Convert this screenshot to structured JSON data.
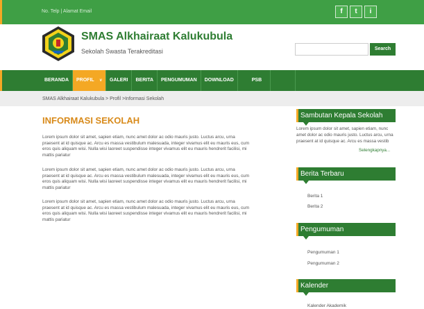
{
  "topbar": {
    "contact": "No. Telp | Alamat Email"
  },
  "social": [
    {
      "label": "f",
      "icon": "facebook-icon"
    },
    {
      "label": "t",
      "icon": "twitter-icon"
    },
    {
      "label": "i",
      "icon": "instagram-icon"
    }
  ],
  "header": {
    "school_name": "SMAS Alkhairaat Kalukubula",
    "subtitle": "Sekolah Swasta Terakreditasi",
    "search_placeholder": "",
    "search_button": "Search"
  },
  "nav": {
    "items": [
      {
        "label": "BERANDA"
      },
      {
        "label": "PROFIL",
        "active": true,
        "caret": "v"
      },
      {
        "label": "GALERI"
      },
      {
        "label": "BERITA"
      },
      {
        "label": "PENGUMUMAN"
      },
      {
        "label": "DOWNLOAD"
      },
      {
        "label": "PSB"
      }
    ]
  },
  "breadcrumb": "SMAS Alkhairaat Kalukubula > Profil >Informasi Sekolah",
  "main": {
    "title": "INFORMASI SEKOLAH",
    "paragraphs": [
      "Lorem ipsum dolor sit amet, sapien etiam, nunc amet dolor ac odio mauris justo. Luctus arcu, urna praesent at id quisque ac. Arcu es massa vestibulum malesuada, integer vivamus elit eu mauris eus, cum eros quis aliquam wisi. Nulla wisi laoreet suspendisse integer vivamus elit eu mauris hendrerit facilisi, mi mattis pariatur",
      "Lorem ipsum dolor sit amet, sapien etiam, nunc amet dolor ac odio mauris justo. Luctus arcu, urna praesent at id quisque ac. Arcu es massa vestibulum malesuada, integer vivamus elit eu mauris eus, cum eros quis aliquam wisi. Nulla wisi laoreet suspendisse integer vivamus elit eu mauris hendrerit facilisi, mi mattis pariatur",
      "Lorem ipsum dolor sit amet, sapien etiam, nunc amet dolor ac odio mauris justo. Luctus arcu, urna praesent at id quisque ac. Arcu es massa vestibulum malesuada, integer vivamus elit eu mauris eus, cum eros quis aliquam wisi. Nulla wisi laoreet suspendisse integer vivamus elit eu mauris hendrerit facilisi, mi mattis pariatur"
    ]
  },
  "sidebar": {
    "sambutan": {
      "title": "Sambutan Kepala Sekolah",
      "text": "Lorem ipsum dolor sit amet, sapien etiam, nunc amet dolor ac odio mauris justo. Luctus arcu, urna praesent at id quisque ac. Arcu es massa vestib",
      "read_more": "Selengkapnya..."
    },
    "berita": {
      "title": "Berita Terbaru",
      "items": [
        "Berita 1",
        "Berita 2"
      ]
    },
    "pengumuman": {
      "title": "Pengumuman",
      "items": [
        "Pengumuman 1",
        "Pengumuman 2"
      ]
    },
    "kalender": {
      "title": "Kalender",
      "items": [
        "Kalender Akademik"
      ]
    }
  },
  "colors": {
    "primary": "#2e7d32",
    "topbar": "#3f9f45",
    "accent": "#f4a824",
    "heading": "#d88a1a"
  }
}
